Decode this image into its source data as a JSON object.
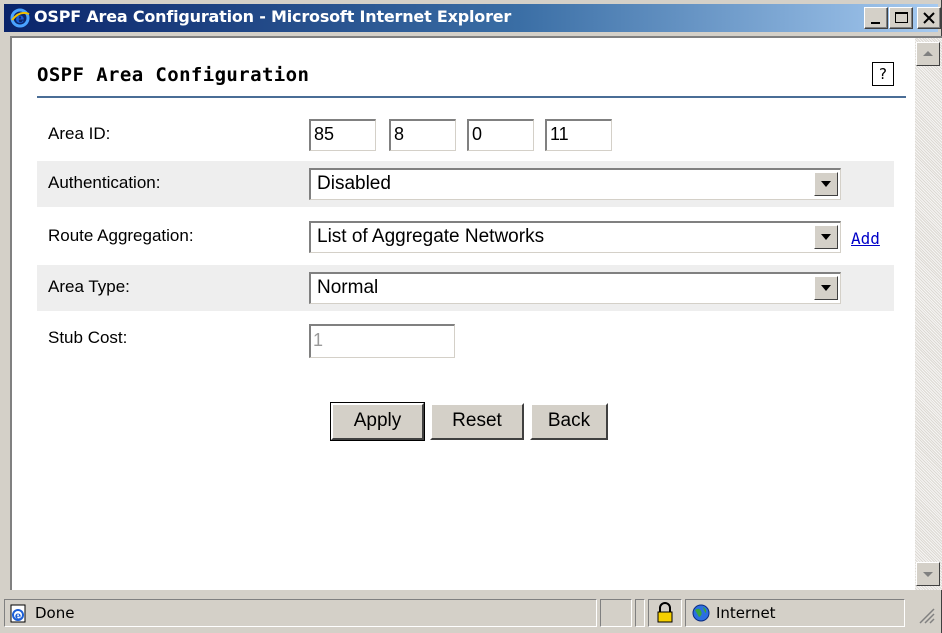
{
  "window": {
    "title": "OSPF Area Configuration - Microsoft Internet Explorer"
  },
  "page": {
    "heading": "OSPF Area Configuration",
    "help_label": "?"
  },
  "form": {
    "area_id": {
      "label": "Area ID:",
      "octets": [
        "85",
        "8",
        "0",
        "11"
      ]
    },
    "authentication": {
      "label": "Authentication:",
      "selected": "Disabled"
    },
    "route_aggregation": {
      "label": "Route Aggregation:",
      "selected": "List of Aggregate Networks",
      "add_link": "Add"
    },
    "area_type": {
      "label": "Area Type:",
      "selected": "Normal"
    },
    "stub_cost": {
      "label": "Stub Cost:",
      "value": "1",
      "disabled": true
    }
  },
  "buttons": {
    "apply": "Apply",
    "reset": "Reset",
    "back": "Back"
  },
  "statusbar": {
    "status": "Done",
    "zone": "Internet",
    "icons": [
      "ie-page-icon",
      "lock-icon",
      "globe-icon"
    ]
  },
  "colors": {
    "title_gradient_start": "#0a246a",
    "title_gradient_end": "#a6caf0",
    "heading_rule": "#4a6d96",
    "row_shade": "#eeeeee",
    "link": "#0000c8"
  }
}
